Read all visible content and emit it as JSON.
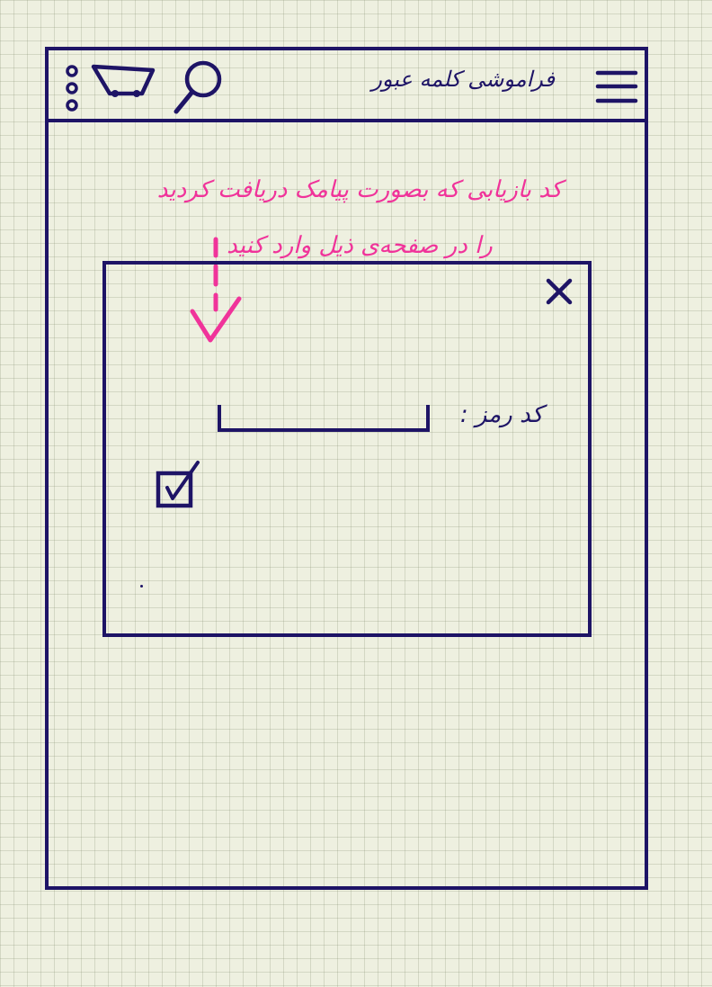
{
  "header": {
    "title": "فراموشی کلمه عبور",
    "icons": {
      "menu": "hamburger-menu-icon",
      "search": "search-icon",
      "cart": "shopping-cart-icon",
      "more": "more-vertical-icon"
    }
  },
  "instruction": {
    "line1": "کد بازیابی که بصورت پیامک دریافت کردید",
    "line2": "را در صفحه‌ی ذیل وارد کنید"
  },
  "dialog": {
    "code_label": "کد رمز :",
    "code_input_value": "",
    "checkbox_checked": true
  },
  "colors": {
    "ink": "#1e1466",
    "annotation": "#f0339a",
    "paper": "#eef0e0"
  }
}
